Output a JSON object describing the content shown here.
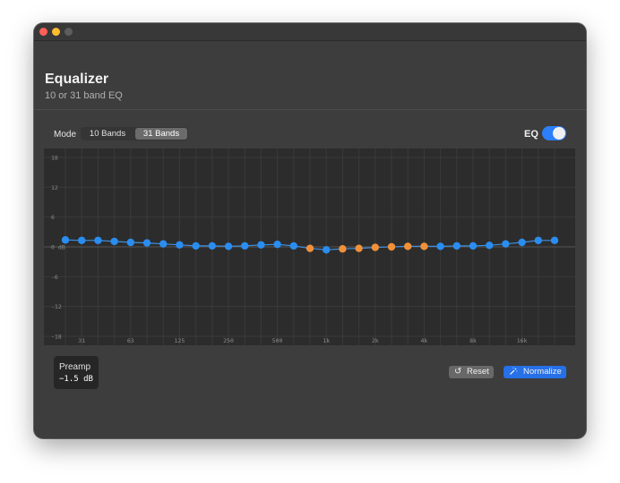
{
  "header": {
    "title": "Equalizer",
    "subtitle": "10 or 31 band EQ"
  },
  "mode": {
    "label": "Mode",
    "options": [
      "10 Bands",
      "31 Bands"
    ],
    "selected": "31 Bands"
  },
  "eq_toggle": {
    "label": "EQ",
    "enabled": true,
    "color": "#2d7ff9"
  },
  "graph": {
    "y_ticks": [
      "18",
      "12",
      "6",
      "0 dB",
      "-6",
      "-12",
      "-18"
    ],
    "y_values": [
      18,
      12,
      6,
      0,
      -6,
      -12,
      -18
    ],
    "x_ticks": [
      "31",
      "63",
      "125",
      "250",
      "500",
      "1k",
      "2k",
      "4k",
      "8k",
      "16k"
    ],
    "band_count": 31,
    "gains_db": [
      1.4,
      1.3,
      1.3,
      1.1,
      0.9,
      0.8,
      0.6,
      0.4,
      0.2,
      0.2,
      0.1,
      0.2,
      0.4,
      0.5,
      0.2,
      -0.3,
      -0.6,
      -0.4,
      -0.3,
      -0.1,
      0.0,
      0.1,
      0.1,
      0.1,
      0.2,
      0.2,
      0.3,
      0.6,
      0.9,
      1.3,
      1.3
    ],
    "band_colors": [
      "blue",
      "blue",
      "blue",
      "blue",
      "blue",
      "blue",
      "blue",
      "blue",
      "blue",
      "blue",
      "blue",
      "blue",
      "blue",
      "blue",
      "blue",
      "orange",
      "blue",
      "orange",
      "orange",
      "orange",
      "orange",
      "orange",
      "orange",
      "blue",
      "blue",
      "blue",
      "blue",
      "blue",
      "blue",
      "blue",
      "blue"
    ],
    "colors": {
      "blue": "#2a8df0",
      "orange": "#f0913a",
      "line": "#3f8fe0"
    }
  },
  "preamp": {
    "label": "Preamp",
    "value": "−1.5 dB"
  },
  "buttons": {
    "reset_label": "Reset",
    "reset_icon": "reset-arrow-icon",
    "normalize_label": "Normalize",
    "normalize_icon": "magic-wand-icon"
  }
}
